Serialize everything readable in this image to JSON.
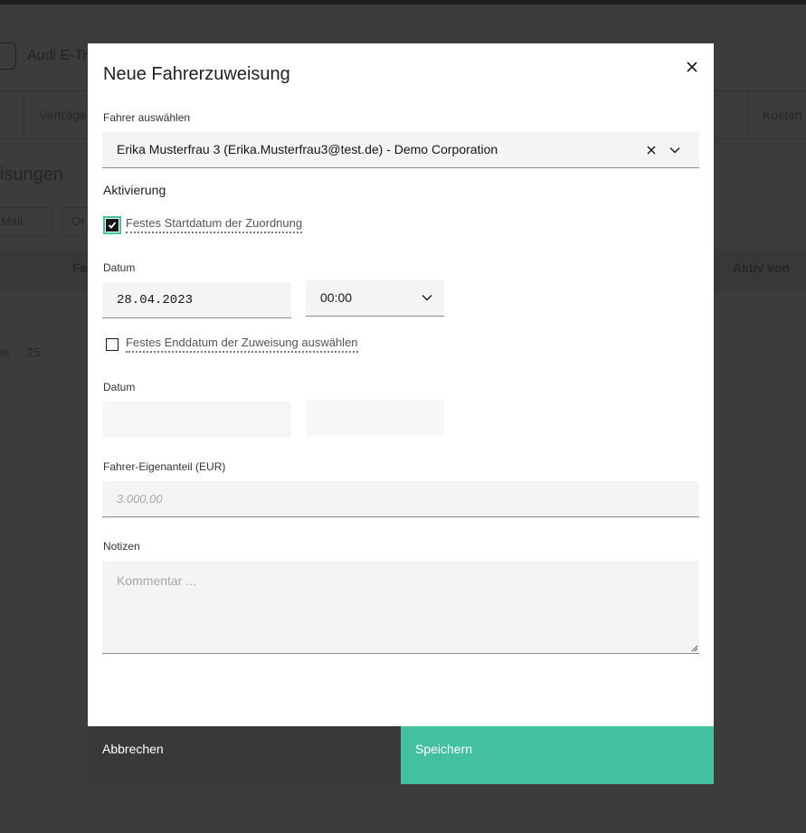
{
  "background": {
    "vehicle": "Audi E-Tr",
    "tab_left": "Verträge",
    "tab_right": "Kosten",
    "heading": "isungen",
    "filter_email": "Mail",
    "filter_other": "Or",
    "col_left": "Fa",
    "col_right": "Aktiv von",
    "pagination_label": "te",
    "pagination_size": "25"
  },
  "modal": {
    "title": "Neue Fahrerzuweisung",
    "driver_label": "Fahrer auswählen",
    "driver_value": "Erika Musterfrau 3 (Erika.Musterfrau3@test.de) - Demo Corporation",
    "activation_title": "Aktivierung",
    "start_checkbox_label": "Festes Startdatum der Zuordnung",
    "start_checked": true,
    "start_date_label": "Datum",
    "start_date_value": "28.04.2023",
    "start_time_value": "00:00",
    "end_checkbox_label": "Festes Enddatum der Zuweisung auswählen",
    "end_checked": false,
    "end_date_label": "Datum",
    "contribution_label": "Fahrer-Eigenanteil (EUR)",
    "contribution_placeholder": "3.000,00",
    "notes_label": "Notizen",
    "notes_placeholder": "Kommentar ...",
    "cancel_label": "Abbrechen",
    "save_label": "Speichern"
  },
  "colors": {
    "accent": "#42c0a0",
    "cancel_bg": "#393939",
    "overlay_bg": "#3c3c3c"
  },
  "icons": {
    "close": "close-icon",
    "clear": "clear-icon",
    "chevron": "chevron-down-icon",
    "check": "checkmark-icon"
  }
}
